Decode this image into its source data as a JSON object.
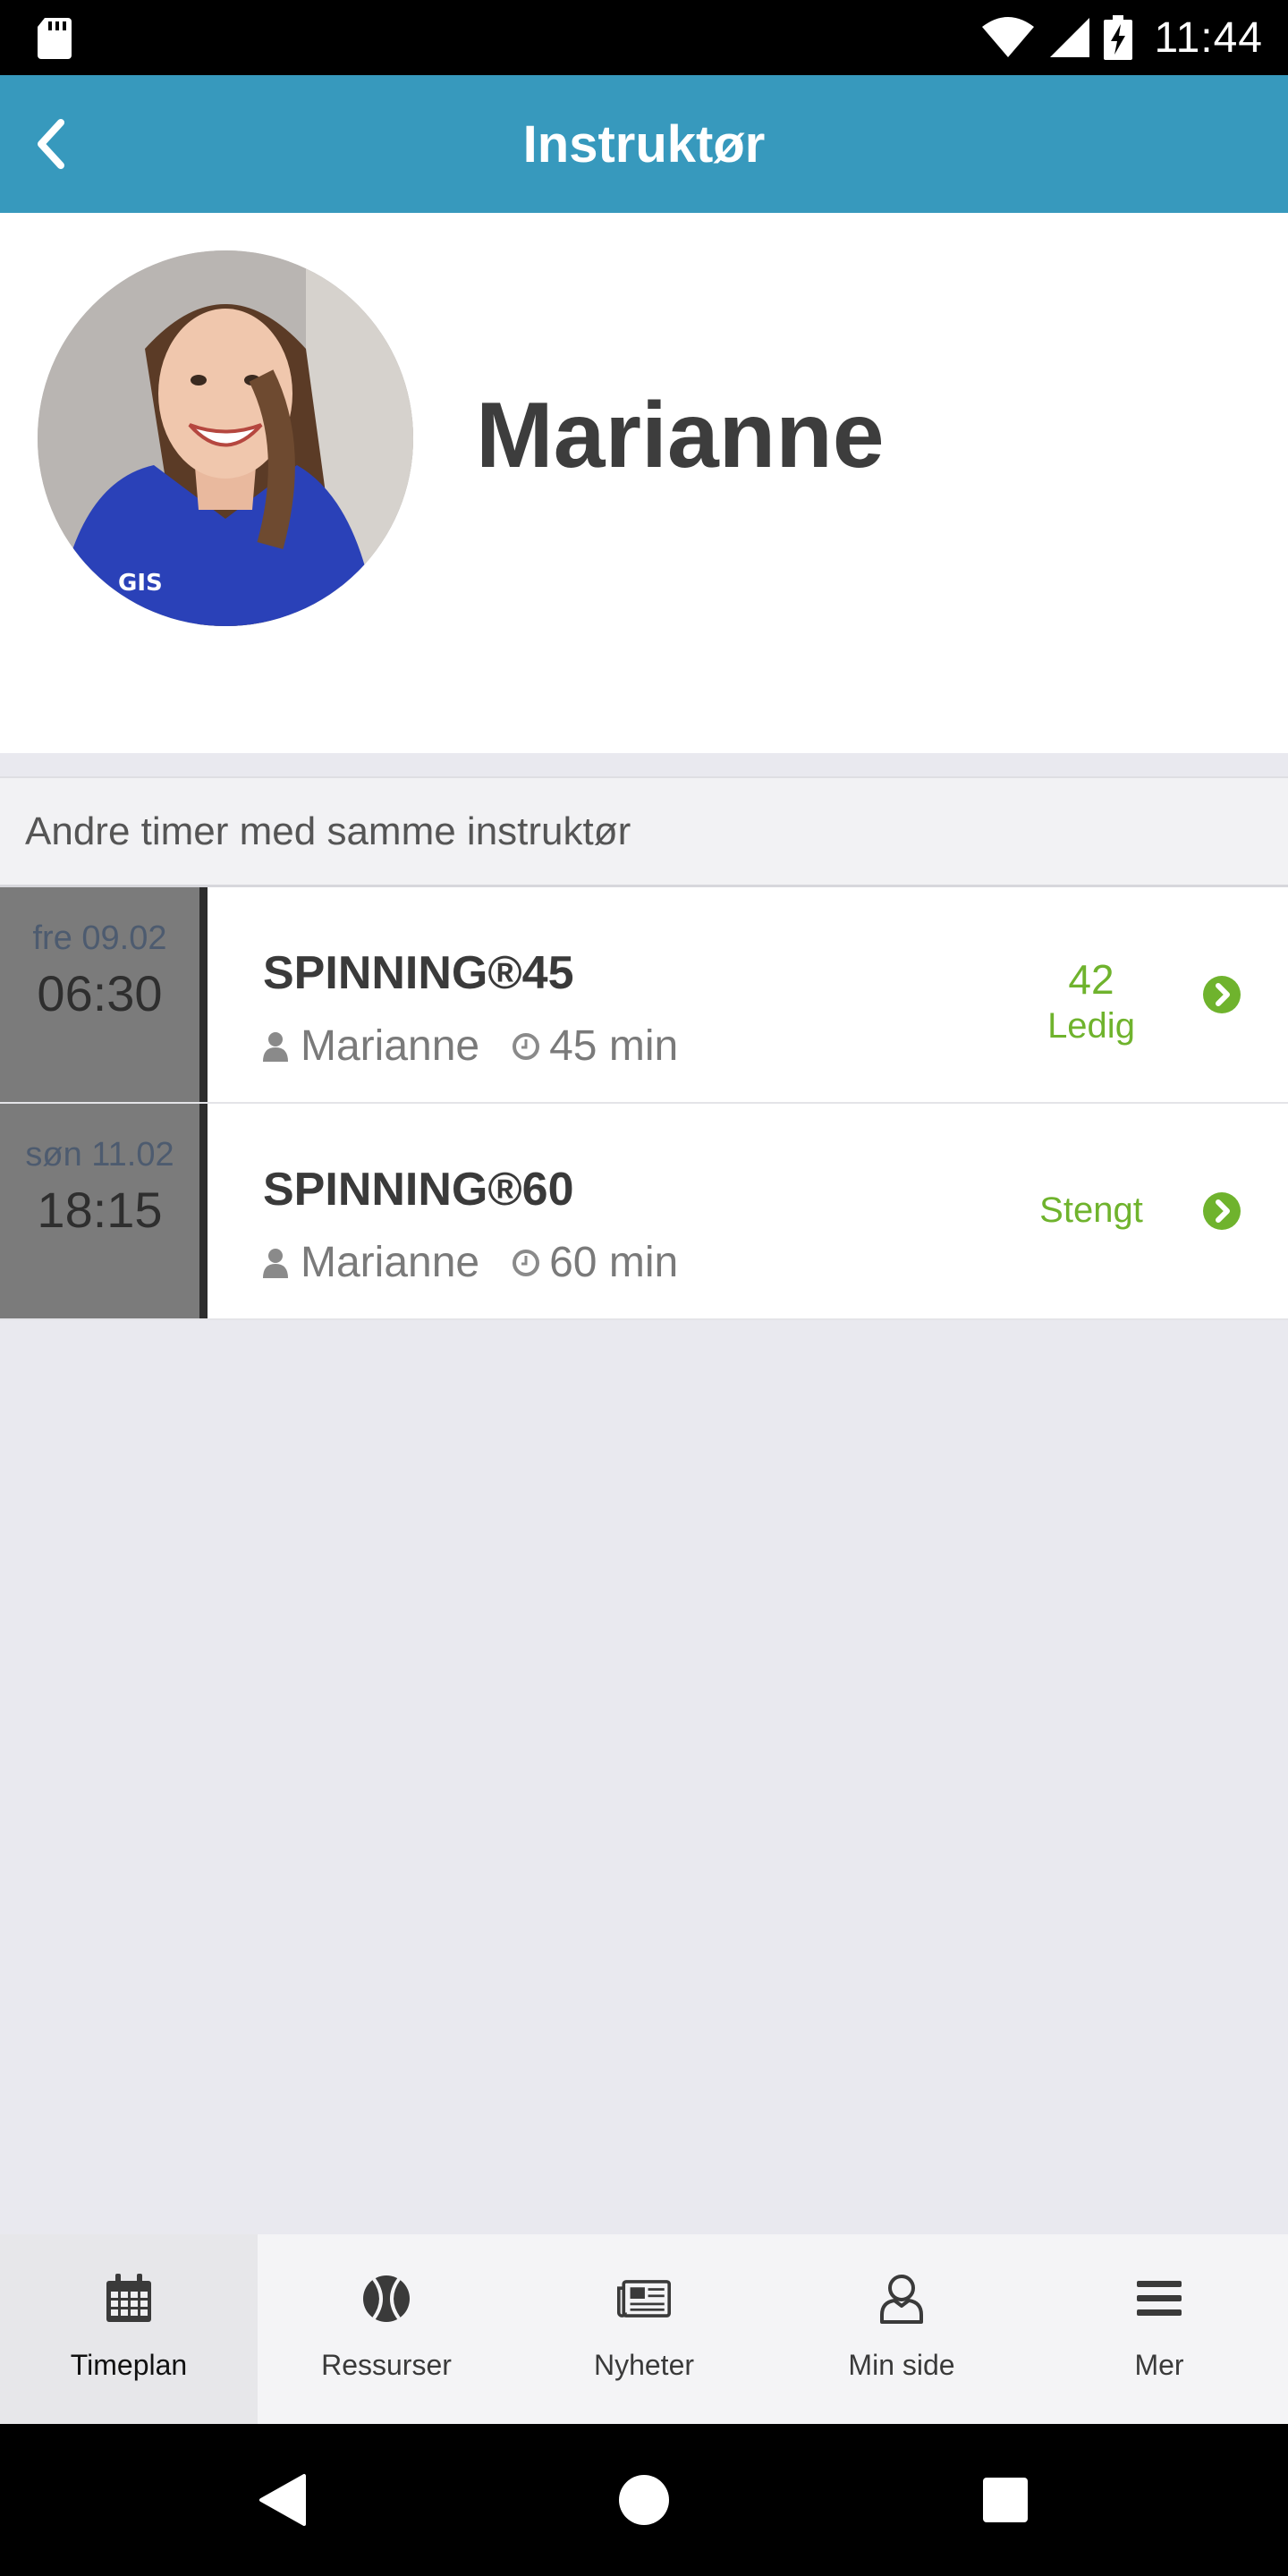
{
  "status_bar": {
    "time": "11:44"
  },
  "app_bar": {
    "title": "Instruktør"
  },
  "profile": {
    "name": "Marianne"
  },
  "section": {
    "heading": "Andre timer med samme instruktør"
  },
  "classes": [
    {
      "day": "fre 09.02",
      "time": "06:30",
      "name": "SPINNING®45",
      "instructor": "Marianne",
      "duration": "45 min",
      "count": "42",
      "status": "Ledig"
    },
    {
      "day": "søn 11.02",
      "time": "18:15",
      "name": "SPINNING®60",
      "instructor": "Marianne",
      "duration": "60 min",
      "count": "",
      "status": "Stengt"
    }
  ],
  "bottom_nav": [
    {
      "label": "Timeplan",
      "icon": "calendar-icon",
      "active": true
    },
    {
      "label": "Ressurser",
      "icon": "ball-icon",
      "active": false
    },
    {
      "label": "Nyheter",
      "icon": "newspaper-icon",
      "active": false
    },
    {
      "label": "Min side",
      "icon": "user-icon",
      "active": false
    },
    {
      "label": "Mer",
      "icon": "menu-icon",
      "active": false
    }
  ],
  "colors": {
    "app_bar": "#3799bd",
    "status_green": "#6fb32d",
    "date_column": "#7b7b7b"
  }
}
